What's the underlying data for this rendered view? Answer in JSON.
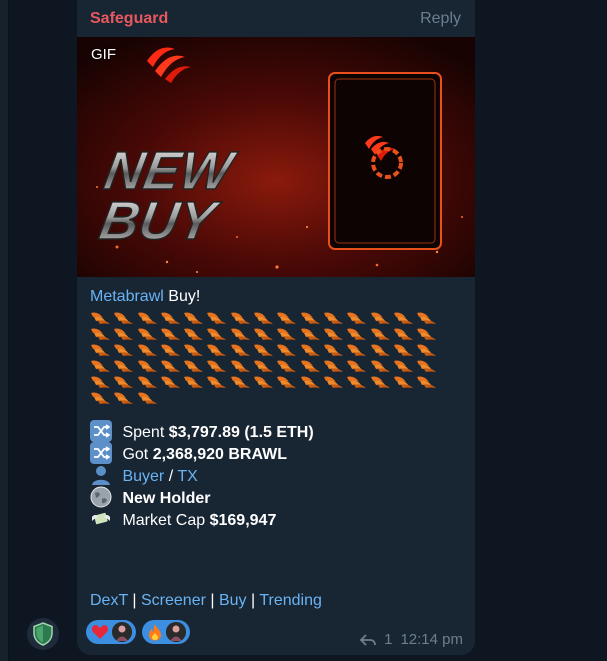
{
  "message": {
    "sender": "Safeguard",
    "reply_label": "Reply",
    "media_label": "GIF",
    "media_text": {
      "line1": "NEW",
      "line2": "BUY"
    },
    "title": {
      "token": "Metabrawl",
      "action": "Buy!"
    },
    "claw_count": 78,
    "stats": {
      "spent_label": "Spent",
      "spent_value": "$3,797.89 (1.5 ETH)",
      "got_label": "Got",
      "got_value": "2,368,920 BRAWL",
      "buyer_label": "Buyer",
      "separator": "/",
      "tx_label": "TX",
      "holder_label": "New Holder",
      "mcap_label": "Market Cap",
      "mcap_value": "$169,947"
    },
    "links": [
      "DexT",
      "Screener",
      "Buy",
      "Trending"
    ],
    "link_separator": "|",
    "reactions": [
      {
        "emoji": "❤️",
        "icon": "heart-icon"
      },
      {
        "emoji": "🔥",
        "icon": "fire-icon"
      }
    ],
    "reply_count": "1",
    "time": "12:14 pm"
  },
  "colors": {
    "background": "#0e1621",
    "bubble": "#182533",
    "sender": "#e8585f",
    "link": "#6ab3f3",
    "reaction_pill": "#3b8ee0",
    "meta": "#6d7f8f",
    "accent_orange": "#e8731c"
  }
}
